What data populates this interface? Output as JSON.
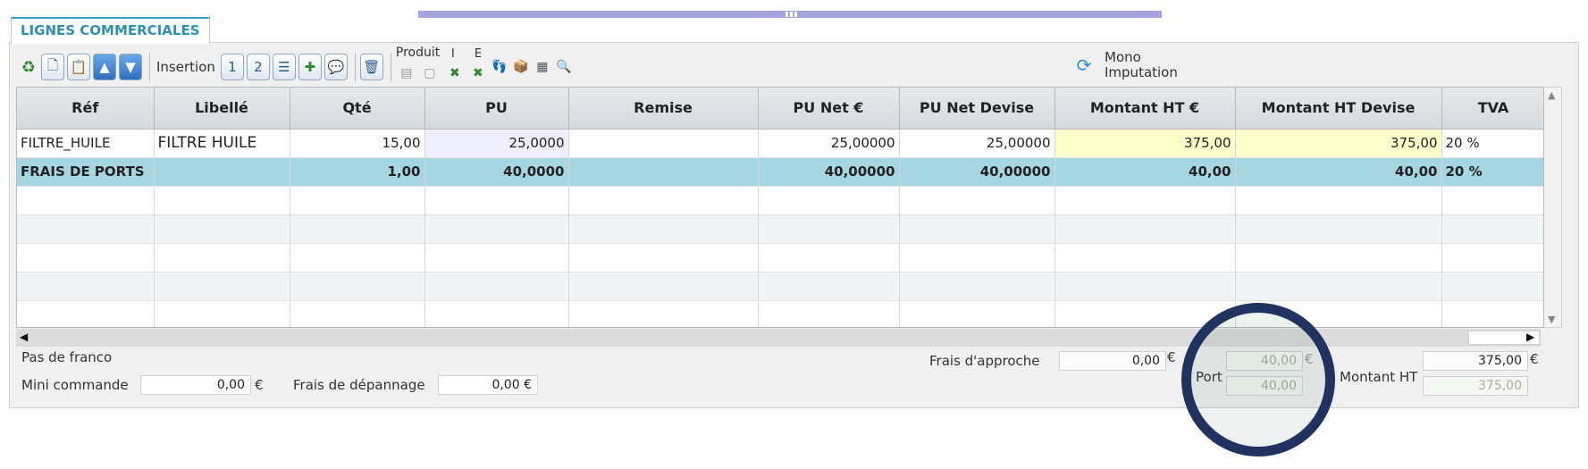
{
  "tab": {
    "title": "LIGNES COMMERCIALES"
  },
  "toolbar": {
    "insertion_label": "Insertion",
    "btn_1": "1",
    "btn_2": "2",
    "produit_label": "Produit",
    "i_label": "I",
    "e_label": "E",
    "mono_line1": "Mono",
    "mono_line2": "Imputation"
  },
  "grid": {
    "columns": [
      "Réf",
      "Libellé",
      "Qté",
      "PU",
      "Remise",
      "PU Net €",
      "PU Net Devise",
      "Montant HT €",
      "Montant HT Devise",
      "TVA"
    ],
    "rows": [
      {
        "ref": "FILTRE_HUILE",
        "libelle": "FILTRE HUILE",
        "qte": "15,00",
        "pu": "25,0000",
        "remise": "",
        "pu_net": "25,00000",
        "pu_net_devise": "25,00000",
        "montant_ht": "375,00",
        "montant_ht_devise": "375,00",
        "tva": "20 %"
      },
      {
        "ref": "FRAIS DE PORTS",
        "libelle": "",
        "qte": "1,00",
        "pu": "40,0000",
        "remise": "",
        "pu_net": "40,00000",
        "pu_net_devise": "40,00000",
        "montant_ht": "40,00",
        "montant_ht_devise": "40,00",
        "tva": "20 %"
      }
    ]
  },
  "footer": {
    "pas_de_franco": "Pas de franco",
    "mini_commande_label": "Mini commande",
    "mini_commande_value": "0,00",
    "frais_depannage_label": "Frais de dépannage",
    "frais_depannage_value": "0,00",
    "frais_approche_label": "Frais d'approche",
    "frais_approche_value": "0,00",
    "port_label": "Port",
    "port_value": "40,00",
    "port_devise_value": "40,00",
    "montant_ht_label": "Montant HT",
    "montant_ht_value": "375,00",
    "montant_ht_devise_value": "375,00",
    "currency": "€"
  }
}
